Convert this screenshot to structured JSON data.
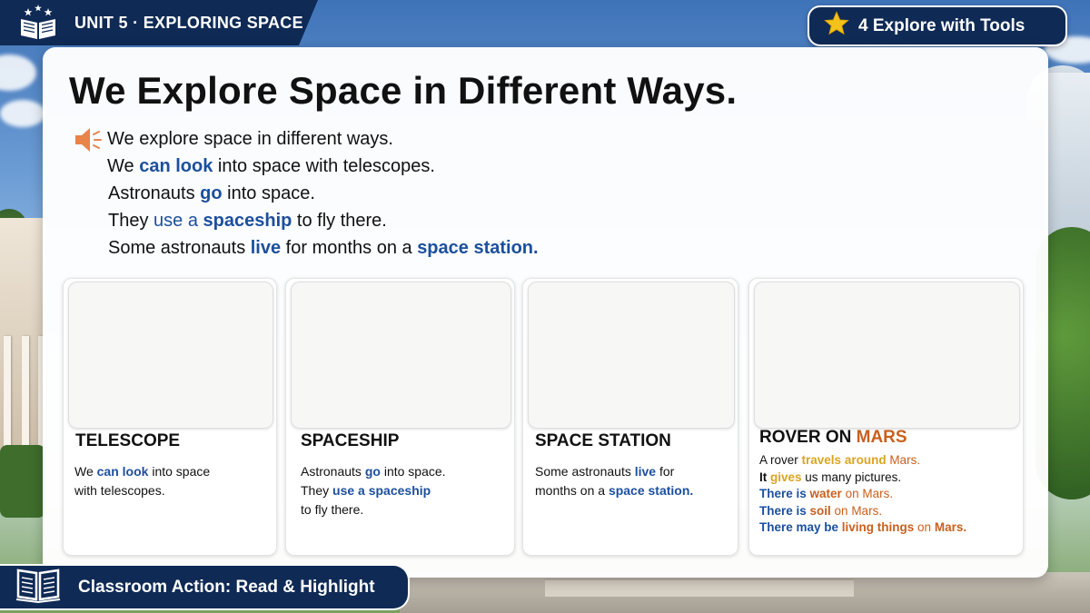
{
  "header": {
    "unit_title": "UNIT 5 · EXPLORING SPACE",
    "tools_label": "4 Explore with Tools"
  },
  "main": {
    "title": "We Explore Space in Different Ways.",
    "lines": [
      [
        {
          "t": "We explore space in different ways.",
          "s": ""
        }
      ],
      [
        {
          "t": "We ",
          "s": ""
        },
        {
          "t": "can look",
          "s": "hl"
        },
        {
          "t": " into space with telescopes.",
          "s": ""
        }
      ],
      [
        {
          "t": "Astronauts ",
          "s": ""
        },
        {
          "t": "go",
          "s": "hl"
        },
        {
          "t": " into space.",
          "s": ""
        }
      ],
      [
        {
          "t": "They ",
          "s": ""
        },
        {
          "t": "use a ",
          "s": "hl-plain"
        },
        {
          "t": "spaceship",
          "s": "hl"
        },
        {
          "t": " to fly there.",
          "s": ""
        }
      ],
      [
        {
          "t": "Some astronauts ",
          "s": ""
        },
        {
          "t": "live",
          "s": "hl"
        },
        {
          "t": " for months on a ",
          "s": ""
        },
        {
          "t": "space station.",
          "s": "hl"
        }
      ]
    ]
  },
  "cards": [
    {
      "title": [
        {
          "t": "TELESCOPE",
          "s": ""
        }
      ],
      "body": [
        [
          {
            "t": "We ",
            "s": ""
          },
          {
            "t": "can look",
            "s": "hl"
          },
          {
            "t": " into space",
            "s": ""
          }
        ],
        [
          {
            "t": "with telescopes.",
            "s": ""
          }
        ]
      ]
    },
    {
      "title": [
        {
          "t": "SPACESHIP",
          "s": ""
        }
      ],
      "body": [
        [
          {
            "t": "Astronauts ",
            "s": ""
          },
          {
            "t": "go",
            "s": "hl"
          },
          {
            "t": " into space.",
            "s": ""
          }
        ],
        [
          {
            "t": "They ",
            "s": ""
          },
          {
            "t": "use a ",
            "s": "hl"
          },
          {
            "t": "spaceship",
            "s": "hl"
          }
        ],
        [
          {
            "t": "to fly there.",
            "s": ""
          }
        ]
      ]
    },
    {
      "title": [
        {
          "t": "SPACE STATION",
          "s": ""
        }
      ],
      "body": [
        [
          {
            "t": "Some astronauts ",
            "s": ""
          },
          {
            "t": "live",
            "s": "hl"
          },
          {
            "t": " for",
            "s": ""
          }
        ],
        [
          {
            "t": "months on a ",
            "s": ""
          },
          {
            "t": "space station.",
            "s": "hl"
          }
        ]
      ]
    },
    {
      "title": [
        {
          "t": "ROVER ON ",
          "s": ""
        },
        {
          "t": "MARS",
          "s": "hl-orange"
        }
      ],
      "body": [
        [
          {
            "t": "A rover ",
            "s": ""
          },
          {
            "t": "travels around",
            "s": "hl-gold"
          },
          {
            "t": " Mars.",
            "s": "hl-orange-plain"
          }
        ],
        [
          {
            "t": "It ",
            "s": "dark-bold"
          },
          {
            "t": "gives",
            "s": "hl-gold"
          },
          {
            "t": " us many pictures.",
            "s": ""
          }
        ],
        [
          {
            "t": "There is ",
            "s": "hl"
          },
          {
            "t": "water",
            "s": "hl-orange"
          },
          {
            "t": " on Mars.",
            "s": "hl-orange-plain"
          }
        ],
        [
          {
            "t": "There is ",
            "s": "hl"
          },
          {
            "t": "soil",
            "s": "hl-orange"
          },
          {
            "t": " on Mars.",
            "s": "hl-orange-plain"
          }
        ],
        [
          {
            "t": "There may be ",
            "s": "hl"
          },
          {
            "t": "living things",
            "s": "hl-orange"
          },
          {
            "t": " on ",
            "s": "hl-orange-plain"
          },
          {
            "t": "Mars.",
            "s": "hl-orange"
          }
        ]
      ]
    }
  ],
  "footer": {
    "action_label": "Classroom Action: Read & Highlight"
  },
  "icons": {
    "unit": "open-book-stars-icon",
    "tools": "star-icon",
    "audio": "speaker-icon",
    "action": "open-book-icon"
  },
  "colors": {
    "navy": "#0f2a55",
    "highlight_blue": "#1c4f9c",
    "highlight_gold": "#d9a521",
    "highlight_orange": "#c8601e",
    "star_yellow": "#f5c21b",
    "speaker_orange": "#e8834a"
  }
}
